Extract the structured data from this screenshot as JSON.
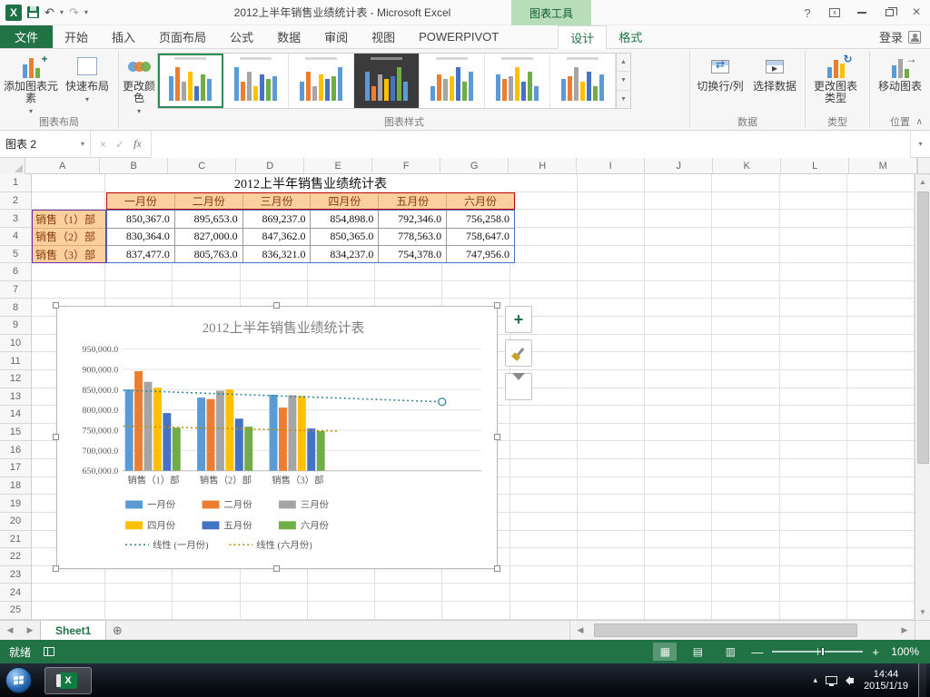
{
  "glyphs": {
    "dropdown": "▾",
    "up": "▲",
    "down": "▼",
    "left": "◀",
    "right": "▶",
    "close": "×",
    "help": "?",
    "check": "✓",
    "cancel": "×",
    "fx": "fx",
    "undo": "↶",
    "redo": "↷",
    "collapse": "∧",
    "new_sheet": "⊕",
    "view_normal": "▦",
    "view_layout": "▤",
    "view_break": "▥",
    "tray_up": "▴",
    "zoom_minus": "—",
    "zoom_plus": "+"
  },
  "titlebar": {
    "title": "2012上半年销售业绩统计表 - Microsoft Excel",
    "context_group": "图表工具"
  },
  "tabs": {
    "file": "文件",
    "main": [
      "开始",
      "插入",
      "页面布局",
      "公式",
      "数据",
      "审阅",
      "视图",
      "POWERPIVOT"
    ],
    "contextual": [
      "设计",
      "格式"
    ],
    "active_contextual": "设计",
    "sign_in": "登录"
  },
  "ribbon": {
    "add_chart_element": "添加图表元素",
    "quick_layout": "快速布局",
    "change_colors": "更改颜色",
    "switch_row_col": "切换行/列",
    "select_data": "选择数据",
    "change_chart_type": "更改图表类型",
    "move_chart": "移动图表",
    "group_labels": {
      "chart_layouts": "图表布局",
      "chart_styles": "图表样式",
      "data": "数据",
      "type": "类型",
      "location": "位置"
    },
    "gallery": {
      "style_count": 7,
      "selected_index": 0,
      "dark_index": 3
    }
  },
  "formula_bar": {
    "name_box": "图表 2"
  },
  "sheet": {
    "col_headers": [
      "A",
      "B",
      "C",
      "D",
      "E",
      "F",
      "G",
      "H",
      "I",
      "J",
      "K",
      "L",
      "M"
    ],
    "row_count": 25,
    "table": {
      "title": "2012上半年销售业绩统计表",
      "month_headers": [
        "一月份",
        "二月份",
        "三月份",
        "四月份",
        "五月份",
        "六月份"
      ],
      "row_labels": [
        "销售（1）部",
        "销售（2）部",
        "销售（3）部"
      ],
      "values": [
        [
          "850,367.0",
          "895,653.0",
          "869,237.0",
          "854,898.0",
          "792,346.0",
          "756,258.0"
        ],
        [
          "830,364.0",
          "827,000.0",
          "847,362.0",
          "850,365.0",
          "778,563.0",
          "758,647.0"
        ],
        [
          "837,477.0",
          "805,763.0",
          "836,321.0",
          "834,237.0",
          "754,378.0",
          "747,956.0"
        ]
      ]
    }
  },
  "chart_data": {
    "type": "bar",
    "title": "2012上半年销售业绩统计表",
    "categories": [
      "销售（1）部",
      "销售（2）部",
      "销售（3）部"
    ],
    "series": [
      {
        "name": "一月份",
        "color": "#5B9BD5",
        "values": [
          850367,
          830364,
          837477
        ]
      },
      {
        "name": "二月份",
        "color": "#ED7D31",
        "values": [
          895653,
          827000,
          805763
        ]
      },
      {
        "name": "三月份",
        "color": "#A5A5A5",
        "values": [
          869237,
          847362,
          836321
        ]
      },
      {
        "name": "四月份",
        "color": "#FFC000",
        "values": [
          854898,
          850365,
          834237
        ]
      },
      {
        "name": "五月份",
        "color": "#4472C4",
        "values": [
          792346,
          778563,
          754378
        ]
      },
      {
        "name": "六月份",
        "color": "#70AD47",
        "values": [
          756258,
          758647,
          747956
        ]
      }
    ],
    "trendlines": [
      {
        "name": "线性 (一月份)",
        "series": "一月份",
        "color": "#31859C",
        "extend_to": 4.0,
        "end_marker": true
      },
      {
        "name": "线性 (六月份)",
        "series": "六月份",
        "color": "#BF8F00",
        "extend_to": 2.55,
        "end_marker": false
      }
    ],
    "ylim": [
      650000,
      950000
    ],
    "ytick_step": 50000,
    "ytick_labels": [
      "650,000.0",
      "700,000.0",
      "750,000.0",
      "800,000.0",
      "850,000.0",
      "900,000.0",
      "950,000.0"
    ],
    "legend_position": "bottom",
    "grid": true
  },
  "sheet_tabs": {
    "active": "Sheet1"
  },
  "status_bar": {
    "ready": "就绪",
    "zoom_level": "100%"
  },
  "taskbar": {
    "time": "14:44",
    "date": "2015/1/19"
  }
}
